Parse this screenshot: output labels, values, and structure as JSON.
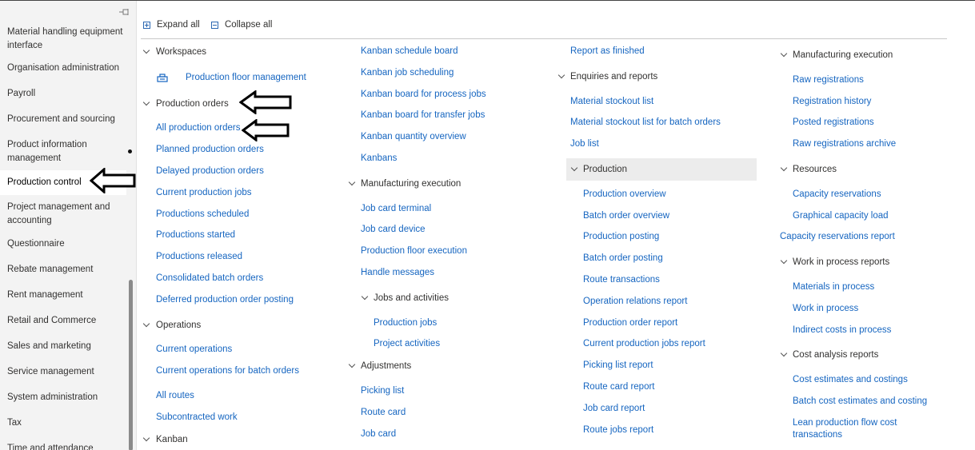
{
  "toolbar": {
    "expand_all": "Expand all",
    "collapse_all": "Collapse all"
  },
  "sidebar": {
    "items": [
      {
        "label": "Material handling equipment interface"
      },
      {
        "label": "Organisation administration"
      },
      {
        "label": "Payroll"
      },
      {
        "label": "Procurement and sourcing"
      },
      {
        "label": "Product information management"
      },
      {
        "label": "Production control"
      },
      {
        "label": "Project management and accounting"
      },
      {
        "label": "Questionnaire"
      },
      {
        "label": "Rebate management"
      },
      {
        "label": "Rent management"
      },
      {
        "label": "Retail and Commerce"
      },
      {
        "label": "Sales and marketing"
      },
      {
        "label": "Service management"
      },
      {
        "label": "System administration"
      },
      {
        "label": "Tax"
      },
      {
        "label": "Time and attendance"
      }
    ]
  },
  "col1": {
    "workspaces": "Workspaces",
    "production_floor_management": "Production floor management",
    "production_orders": "Production orders",
    "links": [
      "All production orders",
      "Planned production orders",
      "Delayed production orders",
      "Current production jobs",
      "Productions scheduled",
      "Productions started",
      "Productions released",
      "Consolidated batch orders",
      "Deferred production order posting"
    ],
    "operations": "Operations",
    "operations_links": [
      "Current operations",
      "Current operations for batch orders",
      "All routes",
      "Subcontracted work"
    ],
    "kanban": "Kanban"
  },
  "col2": {
    "kanban_links": [
      "Kanban schedule board",
      "Kanban job scheduling",
      "Kanban board for process jobs",
      "Kanban board for transfer jobs",
      "Kanban quantity overview",
      "Kanbans"
    ],
    "manufacturing_execution": "Manufacturing execution",
    "me_links": [
      "Job card terminal",
      "Job card device",
      "Production floor execution",
      "Handle messages"
    ],
    "jobs_and_activities": "Jobs and activities",
    "ja_links": [
      "Production jobs",
      "Project activities"
    ],
    "adjustments": "Adjustments",
    "adj_links": [
      "Picking list",
      "Route card",
      "Job card"
    ]
  },
  "col3": {
    "report_as_finished": "Report as finished",
    "enquiries_and_reports": "Enquiries and reports",
    "er_links": [
      "Material stockout list",
      "Material stockout list for batch orders",
      "Job list"
    ],
    "production": "Production",
    "prod_links": [
      "Production overview",
      "Batch order overview",
      "Production posting",
      "Batch order posting",
      "Route transactions",
      "Operation relations report",
      "Production order report",
      "Current production jobs report",
      "Picking list report",
      "Route card report",
      "Job card report",
      "Route jobs report"
    ]
  },
  "col4": {
    "manufacturing_execution": "Manufacturing execution",
    "me_links": [
      "Raw registrations",
      "Registration history",
      "Posted registrations",
      "Raw registrations archive"
    ],
    "resources": "Resources",
    "res_links": [
      "Capacity reservations",
      "Graphical capacity load"
    ],
    "capacity_reservations_report": "Capacity reservations report",
    "wip_reports": "Work in process reports",
    "wip_links": [
      "Materials in process",
      "Work in process",
      "Indirect costs in process"
    ],
    "cost_analysis_reports": "Cost analysis reports",
    "ca_links": [
      "Cost estimates and costings",
      "Batch cost estimates and costing",
      "Lean production flow cost transactions"
    ]
  },
  "colors": {
    "link": "#1565c0",
    "text": "#323130",
    "sidebar_bg": "#f3f3f3",
    "highlight_bg": "#ececec"
  },
  "icons": [
    "pin-icon",
    "expand-all-icon",
    "collapse-all-icon",
    "chevron-down-icon",
    "workspace-tile-icon",
    "annotation-arrow-icon"
  ]
}
